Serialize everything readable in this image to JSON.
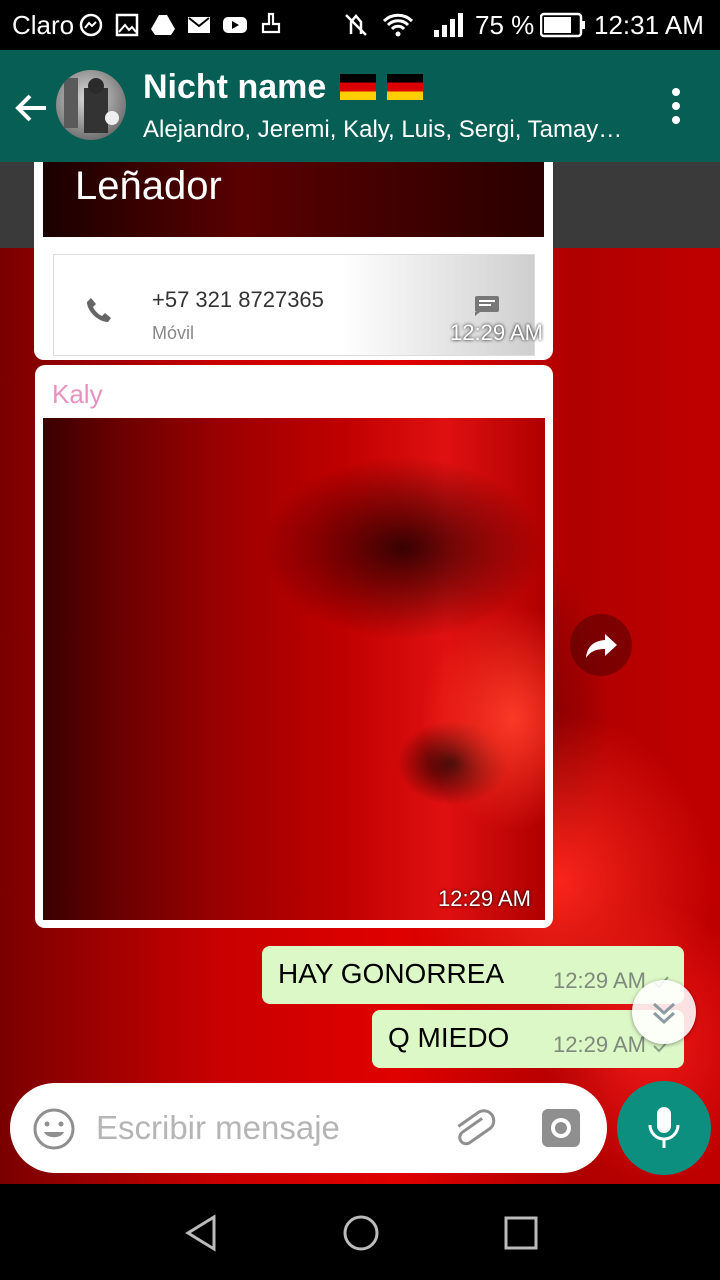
{
  "status_bar": {
    "carrier": "Claro",
    "battery_percent": "75 %",
    "time": "12:31 AM"
  },
  "app_bar": {
    "title": "Nicht name",
    "subtitle": "Alejandro, Jeremi, Kaly, Luis, Sergi, Tamay…",
    "title_emoji": [
      "flag-germany",
      "flag-germany"
    ]
  },
  "messages": {
    "contact_card": {
      "banner_name": "Leñador",
      "phone_number": "+57 321 8727365",
      "phone_type": "Móvil",
      "time": "12:29 AM"
    },
    "image_message": {
      "sender": "Kaly",
      "time": "12:29 AM"
    },
    "outgoing": [
      {
        "text": "HAY GONORREA",
        "time": "12:29 AM"
      },
      {
        "text": "Q MIEDO",
        "time": "12:29 AM"
      }
    ]
  },
  "input_bar": {
    "placeholder": "Escribir mensaje"
  },
  "colors": {
    "app_bar": "#075e54",
    "outgoing_bubble": "#dcf8c6",
    "mic_button": "#0c8f7f",
    "sender_name": "#e891c1"
  }
}
